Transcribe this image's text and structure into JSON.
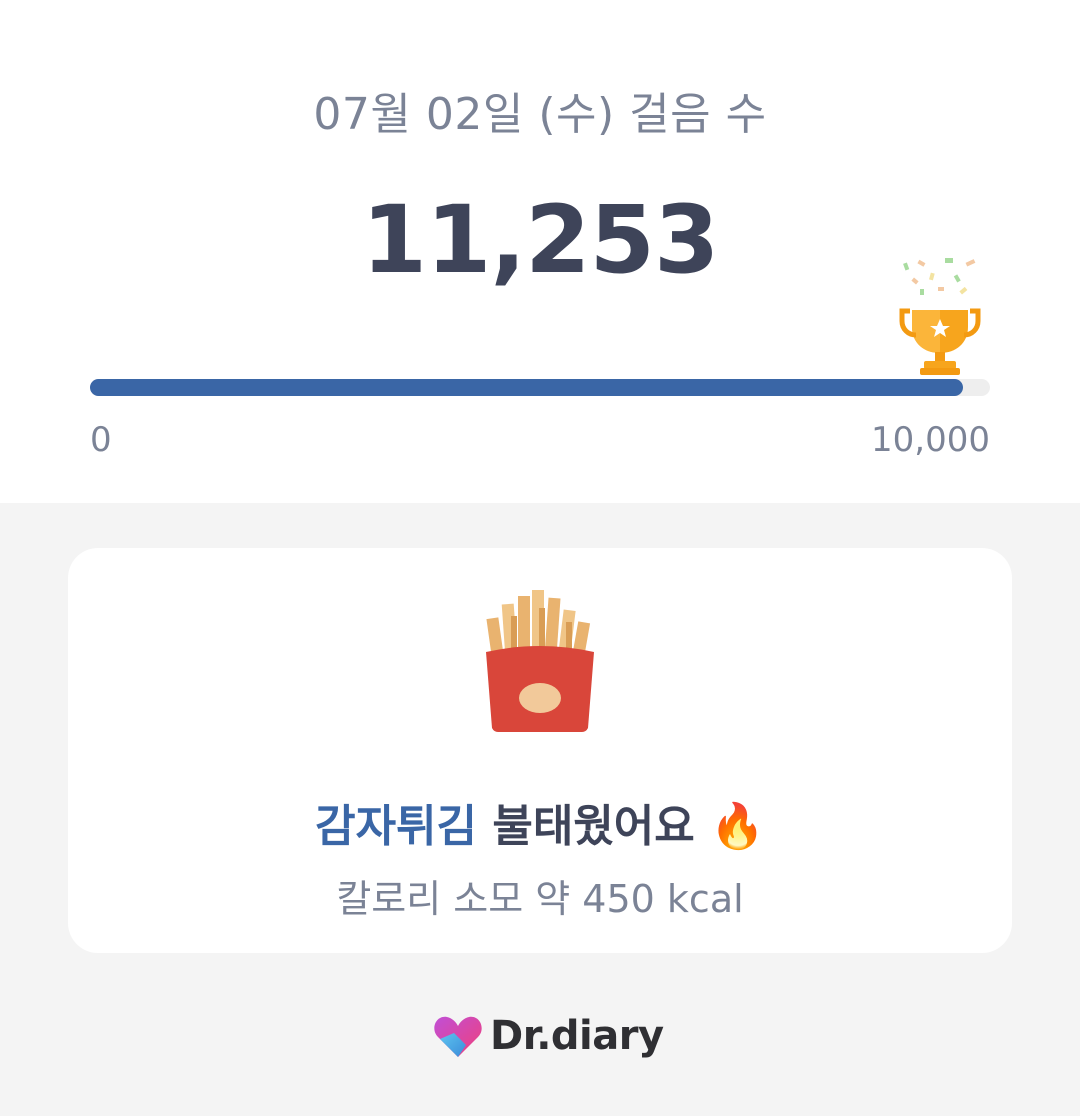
{
  "header": {
    "date_title": "07월 02일 (수) 걸음 수",
    "steps": "11,253"
  },
  "progress": {
    "min_label": "0",
    "max_label": "10,000",
    "fraction": 1.0,
    "bar_color": "#3a66a6",
    "goal_icon": "trophy-icon"
  },
  "burn_card": {
    "food_icon": "french-fries-icon",
    "food_name": "감자튀김",
    "burn_text": "불태웠어요",
    "fire_emoji": "🔥",
    "calorie_text": "칼로리 소모 약 450 kcal"
  },
  "brand": {
    "name": "Dr.diary",
    "logo_icon": "heart-logo-icon"
  },
  "colors": {
    "accent": "#3a66a6",
    "text_dark": "#3e4459",
    "text_muted": "#7b8396"
  }
}
